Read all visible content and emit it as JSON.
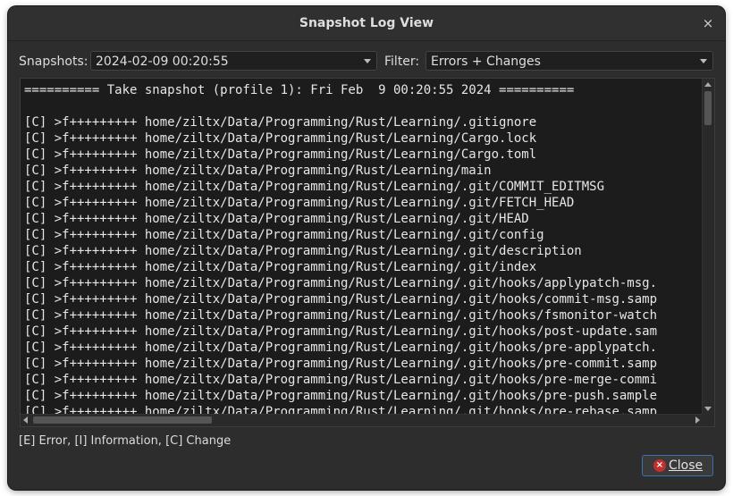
{
  "window": {
    "title": "Snapshot Log View",
    "close_glyph": "×"
  },
  "toolbar": {
    "snapshots_label": "Snapshots:",
    "snapshots_value": "2024-02-09 00:20:55",
    "filter_label": "Filter:",
    "filter_value": "Errors + Changes"
  },
  "log": {
    "lines": [
      "========== Take snapshot (profile 1): Fri Feb  9 00:20:55 2024 ==========",
      "",
      "[C] >f+++++++++ home/ziltx/Data/Programming/Rust/Learning/.gitignore",
      "[C] >f+++++++++ home/ziltx/Data/Programming/Rust/Learning/Cargo.lock",
      "[C] >f+++++++++ home/ziltx/Data/Programming/Rust/Learning/Cargo.toml",
      "[C] >f+++++++++ home/ziltx/Data/Programming/Rust/Learning/main",
      "[C] >f+++++++++ home/ziltx/Data/Programming/Rust/Learning/.git/COMMIT_EDITMSG",
      "[C] >f+++++++++ home/ziltx/Data/Programming/Rust/Learning/.git/FETCH_HEAD",
      "[C] >f+++++++++ home/ziltx/Data/Programming/Rust/Learning/.git/HEAD",
      "[C] >f+++++++++ home/ziltx/Data/Programming/Rust/Learning/.git/config",
      "[C] >f+++++++++ home/ziltx/Data/Programming/Rust/Learning/.git/description",
      "[C] >f+++++++++ home/ziltx/Data/Programming/Rust/Learning/.git/index",
      "[C] >f+++++++++ home/ziltx/Data/Programming/Rust/Learning/.git/hooks/applypatch-msg.",
      "[C] >f+++++++++ home/ziltx/Data/Programming/Rust/Learning/.git/hooks/commit-msg.samp",
      "[C] >f+++++++++ home/ziltx/Data/Programming/Rust/Learning/.git/hooks/fsmonitor-watch",
      "[C] >f+++++++++ home/ziltx/Data/Programming/Rust/Learning/.git/hooks/post-update.sam",
      "[C] >f+++++++++ home/ziltx/Data/Programming/Rust/Learning/.git/hooks/pre-applypatch.",
      "[C] >f+++++++++ home/ziltx/Data/Programming/Rust/Learning/.git/hooks/pre-commit.samp",
      "[C] >f+++++++++ home/ziltx/Data/Programming/Rust/Learning/.git/hooks/pre-merge-commi",
      "[C] >f+++++++++ home/ziltx/Data/Programming/Rust/Learning/.git/hooks/pre-push.sample",
      "[C] >f+++++++++ home/ziltx/Data/Programming/Rust/Learning/.git/hooks/pre-rebase.samp"
    ]
  },
  "legend": "[E] Error, [I] Information, [C] Change",
  "footer": {
    "close_label": "Close",
    "close_icon_glyph": "×"
  },
  "icons": {
    "window_close": "close-icon",
    "button_close": "close-circle-icon",
    "dropdown": "chevron-down-icon"
  }
}
